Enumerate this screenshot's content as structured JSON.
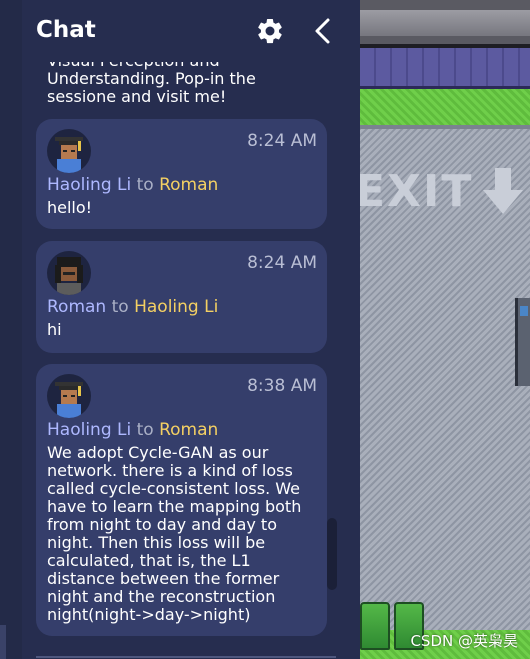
{
  "chat": {
    "title": "Chat",
    "previous_message_tail": "Visual Perception and\nUnderstanding. Pop-in the\nsessione and visit me!",
    "to_word": "to",
    "messages": [
      {
        "time": "8:24 AM",
        "sender": "Haoling Li",
        "recipient": "Roman",
        "body": "hello!",
        "avatar": "haoling-avatar"
      },
      {
        "time": "8:24 AM",
        "sender": "Roman",
        "recipient": "Haoling Li",
        "body": "hi",
        "avatar": "roman-avatar"
      },
      {
        "time": "8:38 AM",
        "sender": "Haoling Li",
        "recipient": "Roman",
        "body": "We adopt Cycle-GAN as our network. there is a kind of loss called cycle-consistent loss. We have to learn the mapping both from night to day and day to night. Then this loss will be calculated, that is, the L1 distance between the former night and the reconstruction night(night->day->night)",
        "avatar": "haoling-avatar"
      }
    ]
  },
  "map": {
    "exit_sign": "EXIT",
    "exit_arrow_icon": "arrow-down-icon"
  },
  "watermark": "CSDN @英枭昊",
  "icons": {
    "settings": "gear-icon",
    "collapse": "chevron-left-icon"
  },
  "colors": {
    "panel_bg": "#262d4f",
    "bubble_bg": "#353e6b",
    "sender": "#aeb8ff",
    "recipient": "#f4d063",
    "time": "#b9bed4"
  }
}
